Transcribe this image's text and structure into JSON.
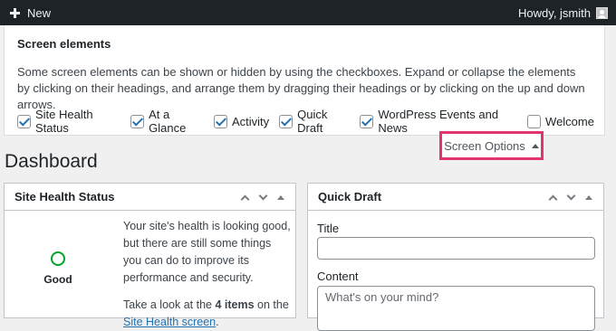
{
  "admin_bar": {
    "new_label": "New",
    "howdy_label": "Howdy, jsmith"
  },
  "screen_options": {
    "heading": "Screen elements",
    "description": "Some screen elements can be shown or hidden by using the checkboxes. Expand or collapse the elements by clicking on their headings, and arrange them by dragging their headings or by clicking on the up and down arrows.",
    "checkboxes": [
      {
        "label": "Site Health Status",
        "checked": true
      },
      {
        "label": "At a Glance",
        "checked": true
      },
      {
        "label": "Activity",
        "checked": true
      },
      {
        "label": "Quick Draft",
        "checked": true
      },
      {
        "label": "WordPress Events and News",
        "checked": true
      },
      {
        "label": "Welcome",
        "checked": false
      }
    ],
    "tab_label": "Screen Options"
  },
  "page": {
    "title": "Dashboard"
  },
  "site_health": {
    "title": "Site Health Status",
    "status": "Good",
    "status_color": "#00a32a",
    "text1": "Your site's health is looking good, but there are still some things you can do to improve its performance and security.",
    "text2_prefix": "Take a look at the ",
    "text2_count": "4 items",
    "text2_mid": " on the ",
    "link_text": "Site Health screen",
    "text2_suffix": "."
  },
  "quick_draft": {
    "title": "Quick Draft",
    "title_label": "Title",
    "title_value": "",
    "content_label": "Content",
    "content_placeholder": "What's on your mind?"
  },
  "colors": {
    "highlight_border": "#e2356f",
    "admin_bar": "#1d2327",
    "link": "#2271b1"
  }
}
